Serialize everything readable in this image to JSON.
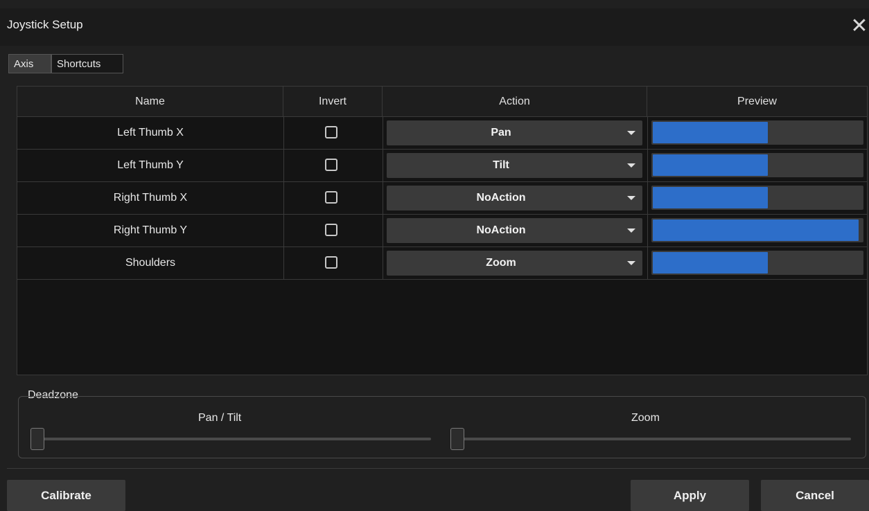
{
  "window": {
    "title": "Joystick Setup",
    "close_glyph": "✕"
  },
  "tabs": [
    {
      "label": "Axis",
      "active": true
    },
    {
      "label": "Shortcuts",
      "active": false
    }
  ],
  "table": {
    "headers": {
      "name": "Name",
      "invert": "Invert",
      "action": "Action",
      "preview": "Preview"
    },
    "rows": [
      {
        "name": "Left Thumb X",
        "invert": false,
        "action": "Pan",
        "preview": 0.55
      },
      {
        "name": "Left Thumb Y",
        "invert": false,
        "action": "Tilt",
        "preview": 0.55
      },
      {
        "name": "Right Thumb X",
        "invert": false,
        "action": "NoAction",
        "preview": 0.55
      },
      {
        "name": "Right Thumb Y",
        "invert": false,
        "action": "NoAction",
        "preview": 0.985
      },
      {
        "name": "Shoulders",
        "invert": false,
        "action": "Zoom",
        "preview": 0.55
      }
    ]
  },
  "deadzone": {
    "title": "Deadzone",
    "pan_tilt": {
      "label": "Pan / Tilt",
      "value": 0
    },
    "zoom": {
      "label": "Zoom",
      "value": 0
    }
  },
  "buttons": {
    "calibrate": "Calibrate",
    "apply": "Apply",
    "cancel": "Cancel"
  },
  "colors": {
    "accent": "#2d6ec9",
    "background": "#202020",
    "panel": "#141414"
  }
}
